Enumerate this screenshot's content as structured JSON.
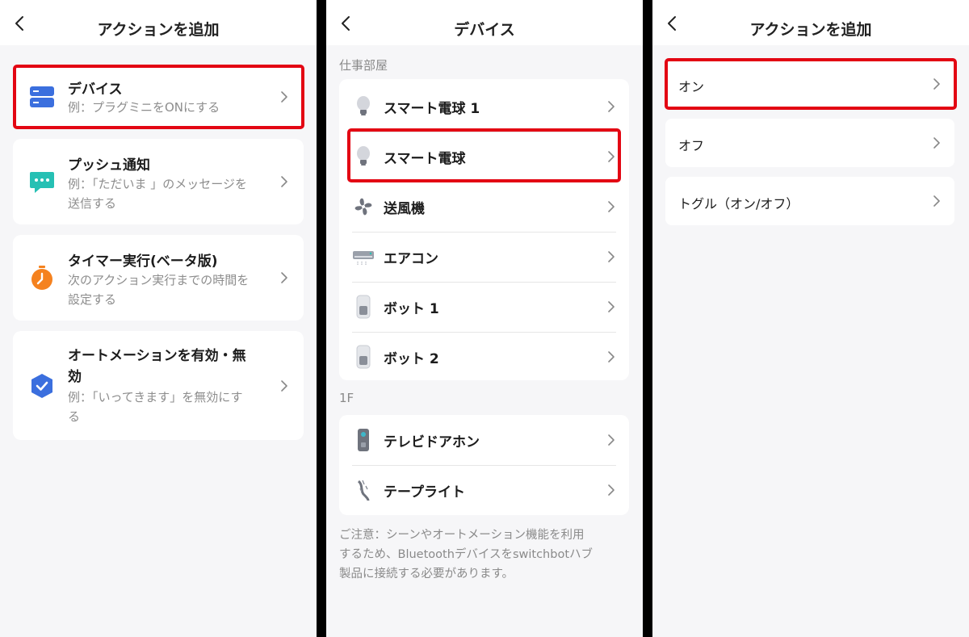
{
  "panels": {
    "left": {
      "title": "アクションを追加",
      "actions": [
        {
          "title": "デバイス",
          "desc": [
            "例：プラグミニをONにする"
          ]
        },
        {
          "title": "プッシュ通知",
          "desc": [
            "例：「ただいま 」のメッセージを",
            "送信する"
          ]
        },
        {
          "title": "タイマー実行(ベータ版)",
          "desc": [
            "次のアクション実行までの時間を",
            "設定する"
          ]
        },
        {
          "title": [
            "オートメーションを有効・無",
            "効"
          ],
          "desc": [
            "例：「いってきます」を無効にす",
            "る"
          ]
        }
      ]
    },
    "middle": {
      "title": "デバイス",
      "sections": [
        {
          "label": "仕事部屋",
          "devices": [
            "スマート電球 1",
            "スマート電球",
            "送風機",
            "エアコン",
            "ボット 1",
            "ボット 2"
          ]
        },
        {
          "label": "1F",
          "devices": [
            "テレビドアホン",
            "テープライト"
          ]
        }
      ],
      "note": [
        "ご注意：シーンやオートメーション機能を利用",
        "するため、Bluetoothデバイスをswitchbotハブ",
        "製品に接続する必要があります。"
      ]
    },
    "right": {
      "title": "アクションを追加",
      "options": [
        "オン",
        "オフ",
        "トグル（オン/オフ）"
      ]
    }
  },
  "colors": {
    "highlight": "#e30613",
    "device_icon": "#3b6fde",
    "notify_icon": "#26c0b4",
    "timer_icon": "#f5821f",
    "automation_icon": "#3b6fde",
    "background": "#f6f6f8"
  },
  "icons": [
    "back-chevron-icon",
    "device-list-icon",
    "chat-bubble-icon",
    "stopwatch-icon",
    "shield-check-icon",
    "bulb-icon",
    "fan-icon",
    "aircon-icon",
    "bot-icon",
    "doorphone-icon",
    "tape-light-icon",
    "chevron-right-icon"
  ]
}
